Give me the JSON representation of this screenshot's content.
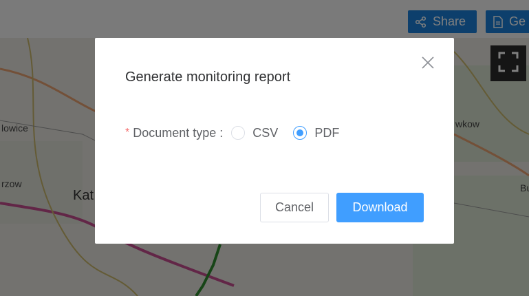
{
  "toolbar": {
    "share_label": "Share",
    "generate_label": "Ge"
  },
  "map": {
    "labels": [
      "lowice",
      "rzow",
      "Kat",
      "wkow",
      "Bu"
    ]
  },
  "dialog": {
    "title": "Generate monitoring report",
    "field": {
      "required_mark": "*",
      "label": "Document type :",
      "options": [
        {
          "label": "CSV",
          "checked": false
        },
        {
          "label": "PDF",
          "checked": true
        }
      ]
    },
    "cancel_label": "Cancel",
    "download_label": "Download"
  },
  "colors": {
    "primary": "#409eff",
    "toolbar_button": "#1a7fd8",
    "required": "#f56c6c"
  }
}
